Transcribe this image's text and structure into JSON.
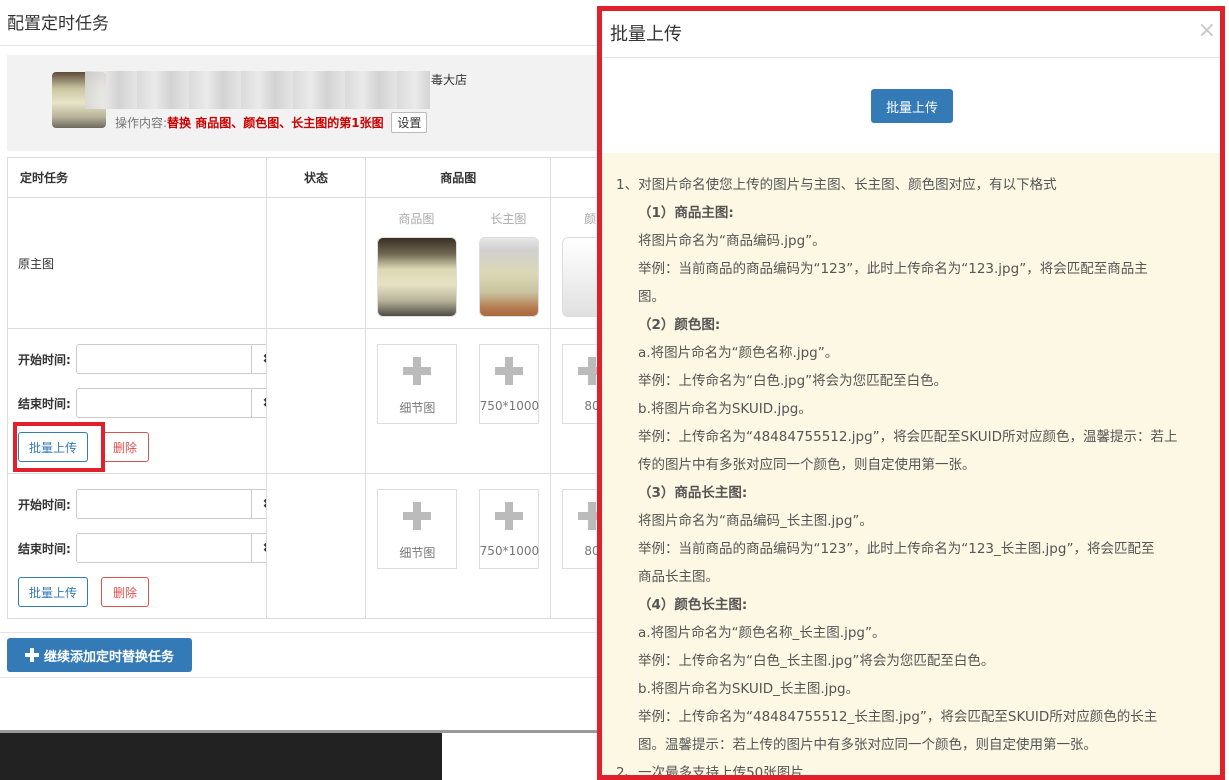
{
  "page": {
    "title": "配置定时任务"
  },
  "product": {
    "shop_name": "毒大店",
    "op_label": "操作内容:",
    "op_value": "替换 商品图、颜色图、长主图的第1张图",
    "setting_label": "设置"
  },
  "table": {
    "headers": {
      "task": "定时任务",
      "status": "状态",
      "images": "商品图"
    },
    "orig_row": {
      "label": "原主图",
      "img_labels": [
        "商品图",
        "长主图",
        "颜"
      ]
    },
    "sched_rows": [
      {
        "start_label": "开始时间:",
        "end_label": "结束时间:",
        "clear": "✖",
        "upload_label": "批量上传",
        "delete_label": "删除",
        "tiles": [
          "细节图",
          "750*1000",
          "80"
        ]
      },
      {
        "start_label": "开始时间:",
        "end_label": "结束时间:",
        "clear": "✖",
        "upload_label": "批量上传",
        "delete_label": "删除",
        "tiles": [
          "细节图",
          "750*1000",
          "80"
        ]
      }
    ]
  },
  "add_task_label": "继续添加定时替换任务",
  "modal": {
    "title": "批量上传",
    "close": "×",
    "upload_button": "批量上传",
    "help": {
      "line1": "1、对图片命名使您上传的图片与主图、长主图、颜色图对应，有以下格式",
      "s1_title": "（1）商品主图:",
      "s1_a": "将图片命名为“商品编码.jpg”。",
      "s1_b": "举例：当前商品的商品编码为“123”，此时上传命名为“123.jpg”，将会匹配至商品主",
      "s1_c": "图。",
      "s2_title": "（2）颜色图:",
      "s2_a": "a.将图片命名为“颜色名称.jpg”。",
      "s2_b": "举例：上传命名为“白色.jpg”将会为您匹配至白色。",
      "s2_c": "b.将图片命名为SKUID.jpg。",
      "s2_d": "举例：上传命名为“48484755512.jpg”，将会匹配至SKUID所对应颜色，温馨提示：若上",
      "s2_e": "传的图片中有多张对应同一个颜色，则自定使用第一张。",
      "s3_title": "（3）商品长主图:",
      "s3_a": "将图片命名为“商品编码_长主图.jpg”。",
      "s3_b": "举例：当前商品的商品编码为“123”，此时上传命名为“123_长主图.jpg”，将会匹配至",
      "s3_c": "商品长主图。",
      "s4_title": "（4）颜色长主图:",
      "s4_a": "a.将图片命名为“颜色名称_长主图.jpg”。",
      "s4_b": "举例：上传命名为“白色_长主图.jpg”将会为您匹配至白色。",
      "s4_c": "b.将图片命名为SKUID_长主图.jpg。",
      "s4_d": "举例：上传命名为“48484755512_长主图.jpg”，将会匹配至SKUID所对应颜色的长主",
      "s4_e": "图。温馨提示：若上传的图片中有多张对应同一个颜色，则自定使用第一张。",
      "line2": "2、一次最多支持上传50张图片"
    }
  }
}
